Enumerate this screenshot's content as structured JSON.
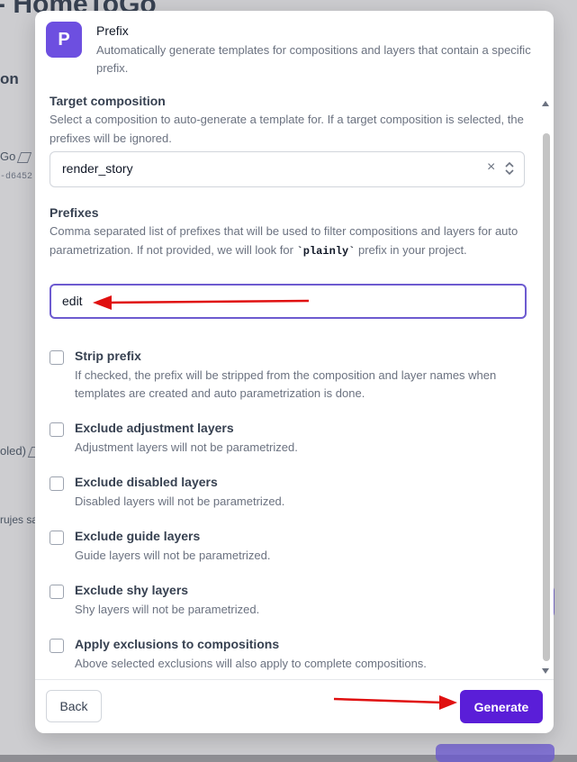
{
  "background": {
    "title": "- HomeToGo",
    "section": "on",
    "item_name": "Go",
    "item_id": "-d6452",
    "item_disabled": "oled)",
    "item_note": "rujes sa"
  },
  "header": {
    "avatar_letter": "P",
    "title": "Prefix",
    "description": "Automatically generate templates for compositions and layers that contain a specific prefix."
  },
  "target_composition": {
    "label": "Target composition",
    "help": "Select a composition to auto-generate a template for. If a target composition is selected, the prefixes will be ignored.",
    "value": "render_story",
    "clear_glyph": "×"
  },
  "prefixes": {
    "label": "Prefixes",
    "help_before": "Comma separated list of prefixes that will be used to filter compositions and layers for auto parametrization. If not provided, we will look for ",
    "help_code": "`plainly`",
    "help_after": " prefix in your project.",
    "value": "edit"
  },
  "options": [
    {
      "label": "Strip prefix",
      "help": "If checked, the prefix will be stripped from the composition and layer names when templates are created and auto parametrization is done.",
      "checked": false
    },
    {
      "label": "Exclude adjustment layers",
      "help": "Adjustment layers will not be parametrized.",
      "checked": false
    },
    {
      "label": "Exclude disabled layers",
      "help": "Disabled layers will not be parametrized.",
      "checked": false
    },
    {
      "label": "Exclude guide layers",
      "help": "Guide layers will not be parametrized.",
      "checked": false
    },
    {
      "label": "Exclude shy layers",
      "help": "Shy layers will not be parametrized.",
      "checked": false
    },
    {
      "label": "Apply exclusions to compositions",
      "help": "Above selected exclusions will also apply to complete compositions.",
      "checked": false
    }
  ],
  "footer": {
    "back_label": "Back",
    "generate_label": "Generate"
  },
  "colors": {
    "accent": "#5a1ed8",
    "avatar": "#6d4fe0",
    "annotation_arrow": "#e01010"
  }
}
